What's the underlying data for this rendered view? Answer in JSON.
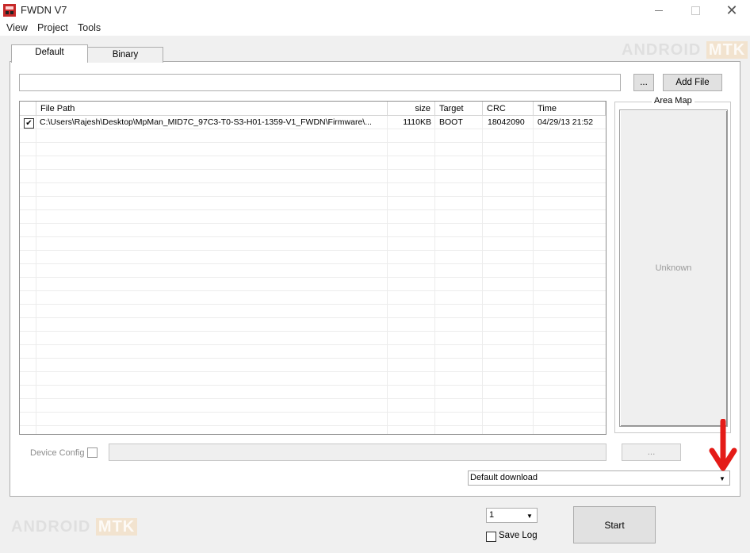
{
  "window": {
    "title": "FWDN V7",
    "minimize": "—",
    "close": "✕"
  },
  "menu": [
    {
      "label": "View"
    },
    {
      "label": "Project"
    },
    {
      "label": "Tools"
    }
  ],
  "watermark": {
    "text": "ANDROID",
    "accent": "MTK"
  },
  "tabs": [
    {
      "label": "Default",
      "active": true
    },
    {
      "label": "Binary",
      "active": false
    }
  ],
  "file_path_input": {
    "value": ""
  },
  "browse_button": {
    "label": "..."
  },
  "add_file_button": {
    "label": "Add File"
  },
  "table": {
    "columns": [
      "",
      "File Path",
      "size",
      "Target",
      "CRC",
      "Time"
    ],
    "rows": [
      {
        "checked": true,
        "file_path": "C:\\Users\\Rajesh\\Desktop\\MpMan_MID7C_97C3-T0-S3-H01-1359-V1_FWDN\\Firmware\\...",
        "size": "1110KB",
        "target": "BOOT",
        "crc": "18042090",
        "time": "04/29/13 21:52"
      }
    ],
    "empty_rows": 22
  },
  "area_map": {
    "title": "Area Map",
    "status": "Unknown"
  },
  "device_config": {
    "label": "Device Config",
    "checked": false,
    "value": "",
    "button": "..."
  },
  "download_mode": {
    "value": "Default download"
  },
  "count_select": {
    "value": "1"
  },
  "save_log": {
    "label": "Save Log",
    "checked": false
  },
  "start_button": {
    "label": "Start"
  },
  "colors": {
    "annotation_arrow": "#e41b17",
    "titlebar": "#ffffff",
    "window_bg": "#f0f0f0"
  }
}
